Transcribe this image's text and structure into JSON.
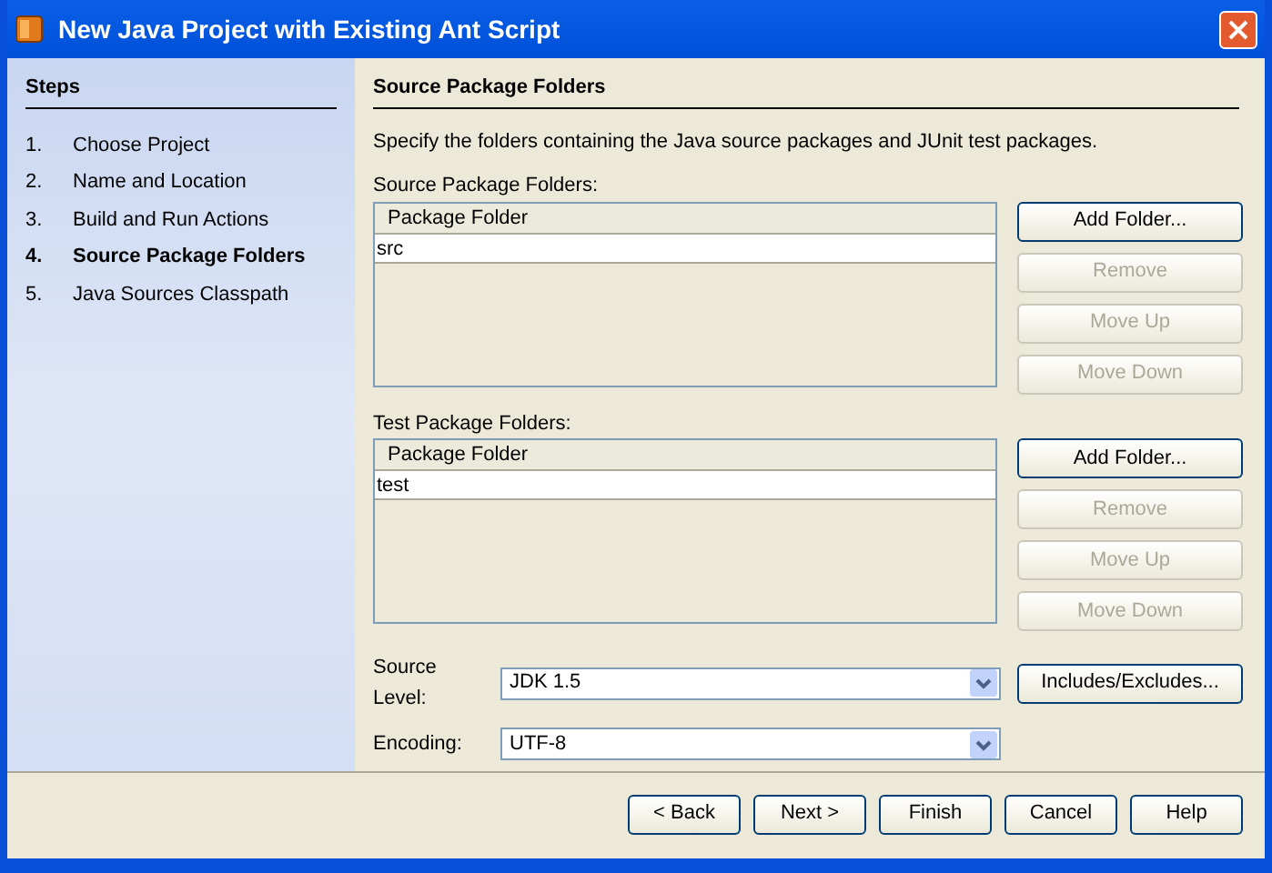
{
  "window": {
    "title": "New Java Project with Existing Ant Script"
  },
  "steps": {
    "heading": "Steps",
    "items": [
      {
        "number": "1.",
        "label": "Choose Project",
        "selected": false
      },
      {
        "number": "2.",
        "label": "Name and Location",
        "selected": false
      },
      {
        "number": "3.",
        "label": "Build and Run Actions",
        "selected": false
      },
      {
        "number": "4.",
        "label": "Source Package Folders",
        "selected": true
      },
      {
        "number": "5.",
        "label": "Java Sources Classpath",
        "selected": false
      }
    ]
  },
  "panel": {
    "heading": "Source Package Folders",
    "description": "Specify the folders containing the Java source packages and JUnit test packages.",
    "lists": [
      {
        "label": "Source Package Folders:",
        "column": "Package Folder",
        "rows": [
          "src"
        ],
        "buttons": [
          {
            "label": "Add Folder...",
            "disabled": false
          },
          {
            "label": "Remove",
            "disabled": true
          },
          {
            "label": "Move Up",
            "disabled": true
          },
          {
            "label": "Move Down",
            "disabled": true
          }
        ]
      },
      {
        "label": "Test Package Folders:",
        "column": "Package Folder",
        "rows": [
          "test"
        ],
        "buttons": [
          {
            "label": "Add Folder...",
            "disabled": false
          },
          {
            "label": "Remove",
            "disabled": true
          },
          {
            "label": "Move Up",
            "disabled": true
          },
          {
            "label": "Move Down",
            "disabled": true
          }
        ]
      }
    ],
    "source_level": {
      "label": "Source Level:",
      "value": "JDK 1.5"
    },
    "includes_button": {
      "label": "Includes/Excludes...",
      "disabled": false
    },
    "encoding": {
      "label": "Encoding:",
      "value": "UTF-8"
    }
  },
  "footer_buttons": [
    {
      "label": "< Back",
      "disabled": false
    },
    {
      "label": "Next >",
      "disabled": false
    },
    {
      "label": "Finish",
      "disabled": false
    },
    {
      "label": "Cancel",
      "disabled": false
    },
    {
      "label": "Help",
      "disabled": false
    }
  ]
}
